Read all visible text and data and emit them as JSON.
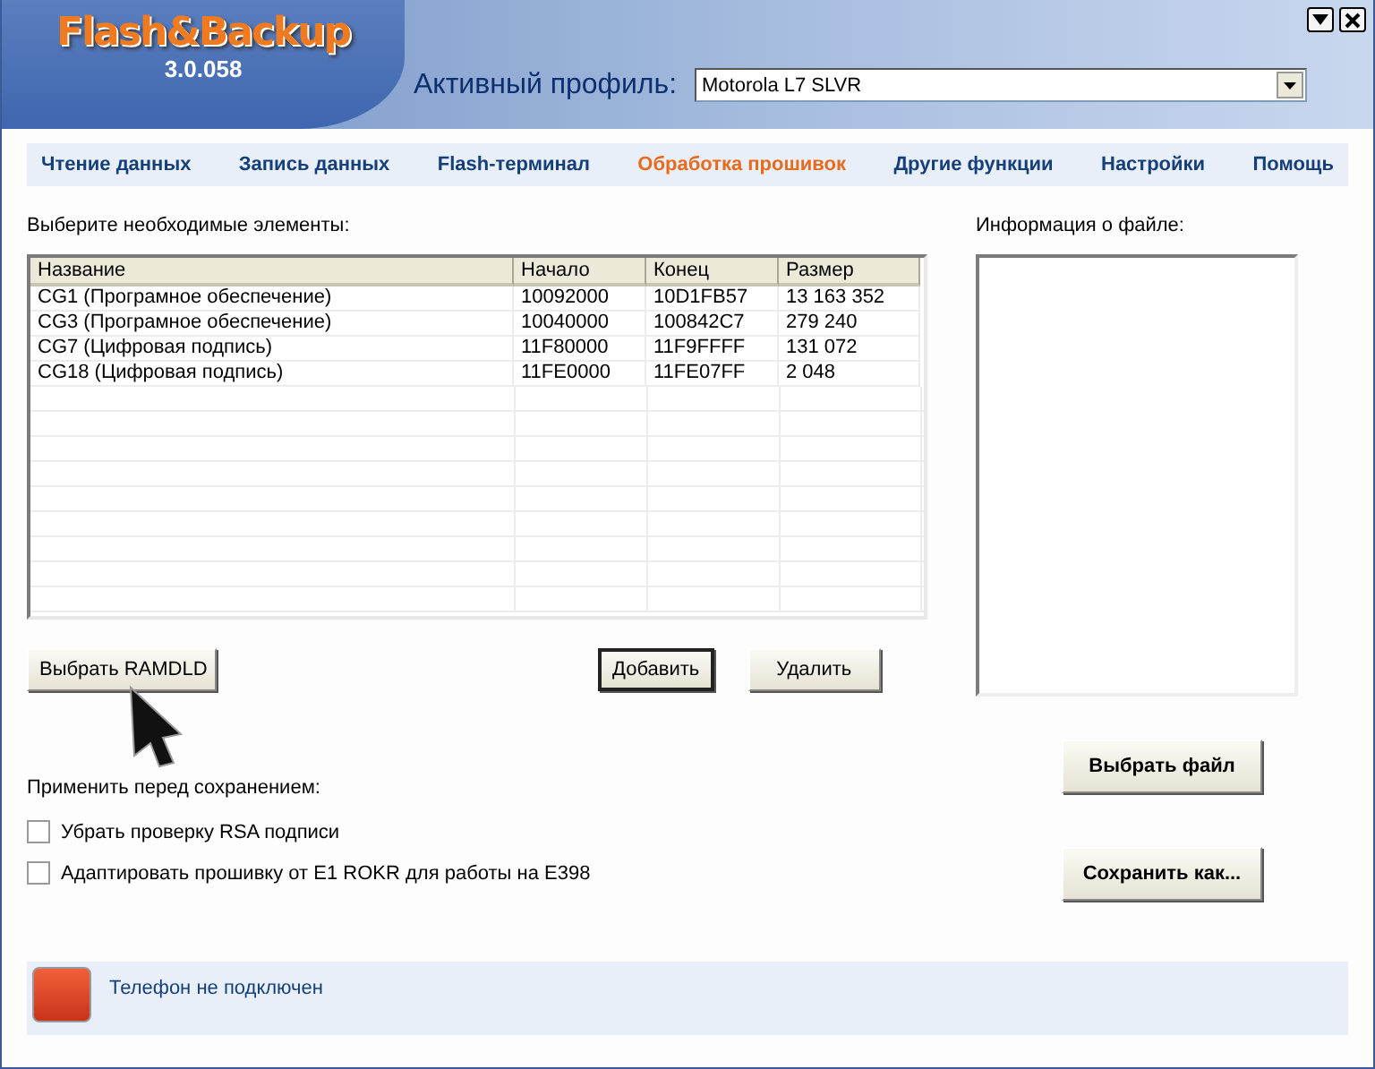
{
  "app": {
    "logo": "Flash&Backup",
    "version": "3.0.058"
  },
  "profile": {
    "label": "Активный профиль:",
    "value": "Motorola L7 SLVR"
  },
  "tabs": [
    {
      "label": "Чтение данных",
      "selected": false
    },
    {
      "label": "Запись данных",
      "selected": false
    },
    {
      "label": "Flash-терминал",
      "selected": false
    },
    {
      "label": "Обработка прошивок",
      "selected": true
    },
    {
      "label": "Другие функции",
      "selected": false
    },
    {
      "label": "Настройки",
      "selected": false
    },
    {
      "label": "Помощь",
      "selected": false
    }
  ],
  "elements_label": "Выберите необходимые элементы:",
  "table": {
    "columns": [
      "Название",
      "Начало",
      "Конец",
      "Размер"
    ],
    "rows": [
      [
        "CG1 (Програмное обеспечение)",
        "10092000",
        "10D1FB57",
        "13 163 352"
      ],
      [
        "CG3 (Програмное обеспечение)",
        "10040000",
        "100842C7",
        "279 240"
      ],
      [
        "CG7 (Цифровая подпись)",
        "11F80000",
        "11F9FFFF",
        "131 072"
      ],
      [
        "CG18 (Цифровая подпись)",
        "11FE0000",
        "11FE07FF",
        "2 048"
      ]
    ]
  },
  "table_buttons": [
    {
      "label": "Выбрать RAMDLD",
      "default": false
    },
    {
      "label": "Добавить",
      "default": true
    },
    {
      "label": "Удалить",
      "default": false
    }
  ],
  "file_info": {
    "label": "Информация о файле:"
  },
  "file_buttons": [
    "Выбрать файл",
    "Сохранить как..."
  ],
  "apply_label": "Применить перед сохранением:",
  "options": [
    {
      "label": "Убрать проверку RSA подписи",
      "checked": false
    },
    {
      "label": "Адаптировать прошивку от E1 ROKR для работы на E398",
      "checked": false
    }
  ],
  "status": {
    "text": "Телефон не подключен",
    "connected": false
  }
}
